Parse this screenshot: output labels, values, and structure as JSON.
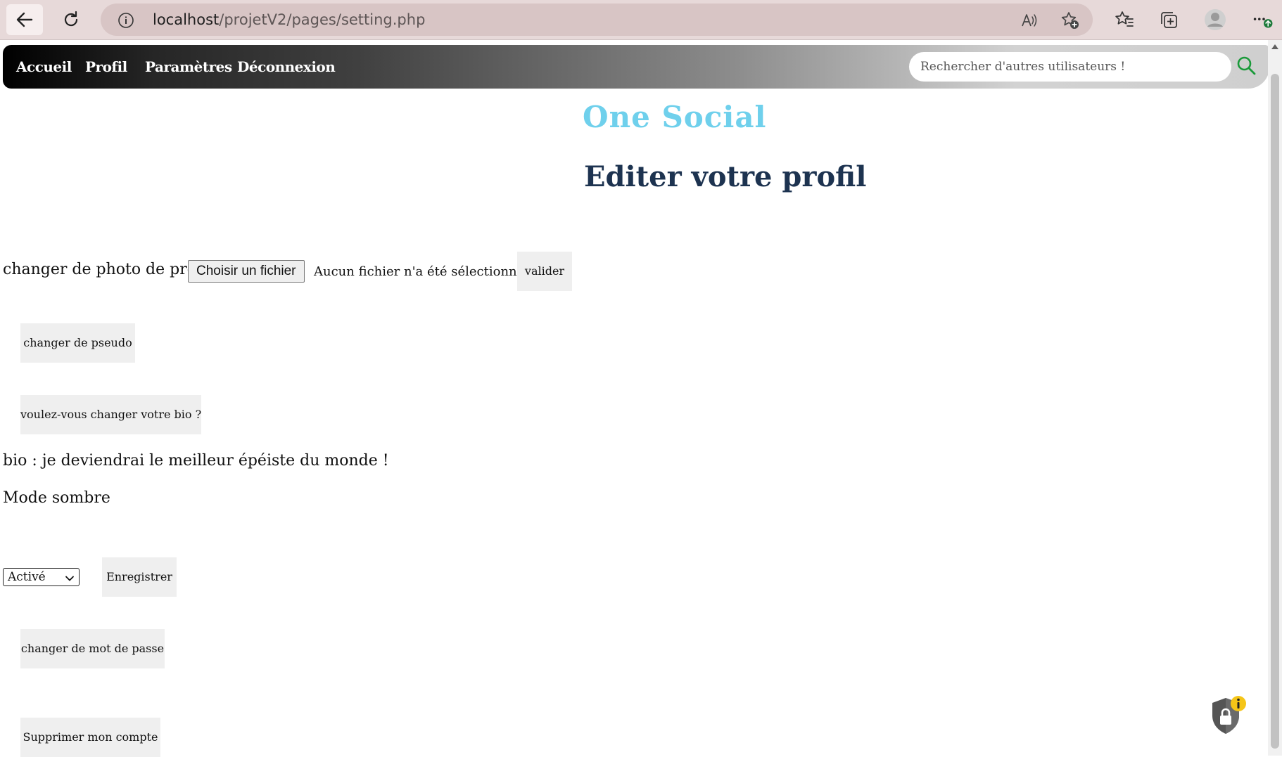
{
  "browser": {
    "url_host": "localhost",
    "url_path": "/projetV2/pages/setting.php"
  },
  "nav": {
    "links": [
      "Accueil",
      "Profil",
      "Paramètres",
      "Déconnexion"
    ],
    "search_placeholder": "Rechercher d'autres utilisateurs !"
  },
  "header": {
    "logo": "One Social",
    "title": "Editer votre profil"
  },
  "form": {
    "photo_label": "changer de photo de profil",
    "file_button": "Choisir un fichier",
    "file_status": "Aucun fichier n'a été sélectionné",
    "valider": "valider",
    "pseudo_button": "changer de pseudo",
    "bio_button": "voulez-vous changer votre bio ?",
    "bio_text": "bio : je deviendrai le meilleur épéiste du monde !",
    "dark_mode_label": "Mode sombre",
    "dark_mode_value": "Activé",
    "save_button": "Enregistrer",
    "password_button": "changer de mot de passe",
    "delete_button": "Supprimer mon compte"
  },
  "colors": {
    "logo": "#6fd0ec",
    "title": "#1d3350",
    "search_icon": "#1a9a3a",
    "browser_chrome": "#e7d9d9",
    "button_bg": "#efefef"
  },
  "icons": {
    "back": "arrow-left-icon",
    "reload": "reload-icon",
    "site_info": "info-icon",
    "read_aloud": "read-aloud-icon",
    "add_favorite": "star-plus-icon",
    "favorites": "favorites-icon",
    "collections": "collections-icon",
    "profile": "avatar-icon",
    "more": "more-icon",
    "search": "search-icon",
    "lock": "lock-shield-icon"
  }
}
